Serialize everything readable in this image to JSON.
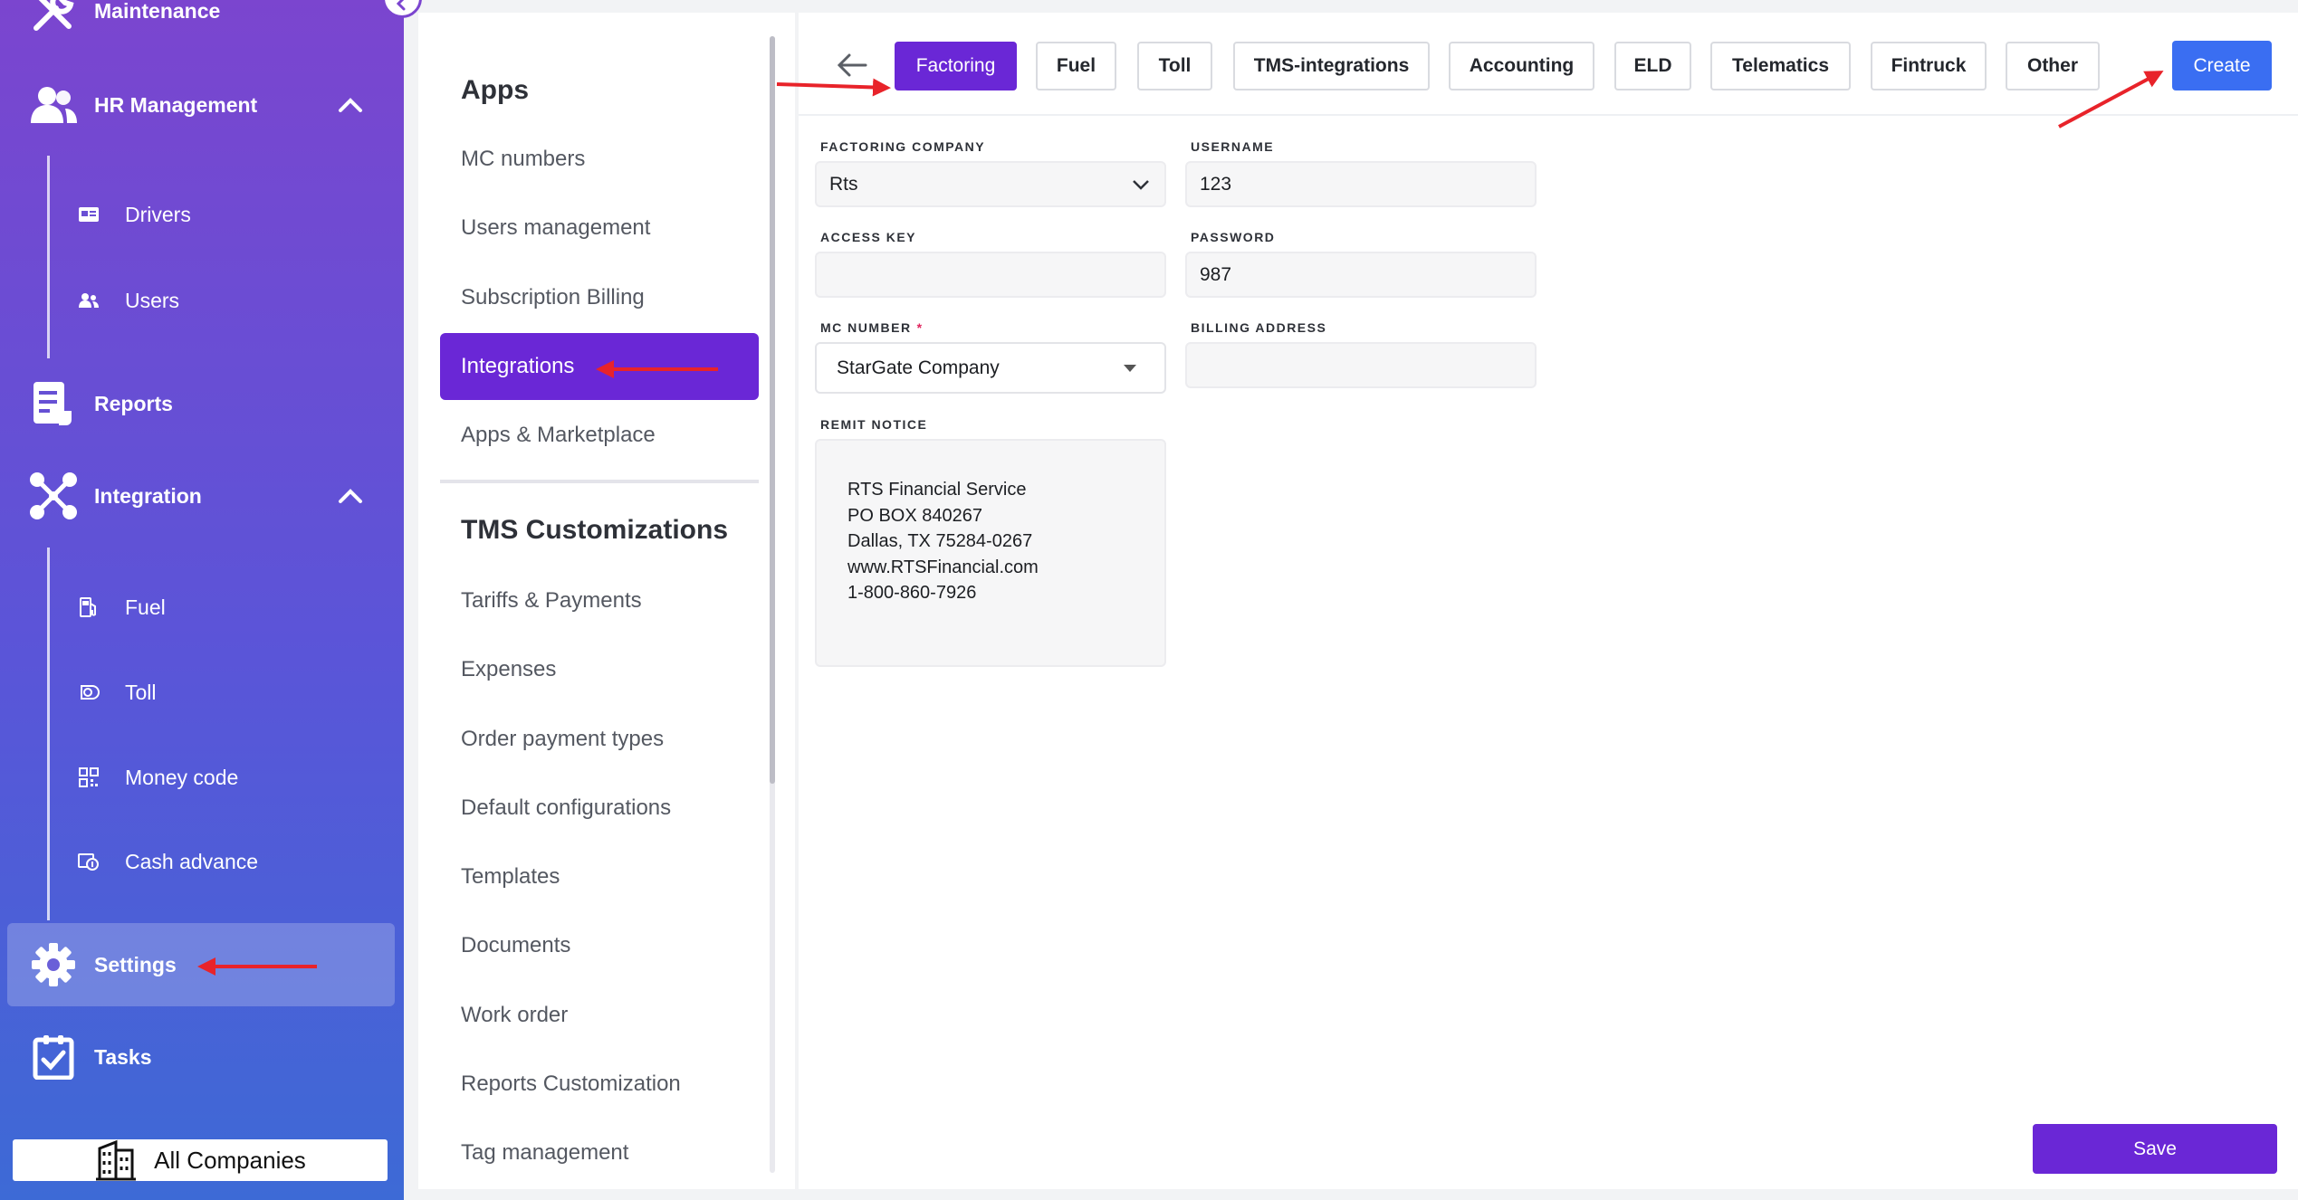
{
  "sidebar": {
    "maintenance_label": "Maintenance",
    "hr_management_label": "HR Management",
    "drivers_label": "Drivers",
    "users_label": "Users",
    "reports_label": "Reports",
    "integration_label": "Integration",
    "fuel_label": "Fuel",
    "toll_label": "Toll",
    "money_code_label": "Money code",
    "cash_advance_label": "Cash advance",
    "settings_label": "Settings",
    "tasks_label": "Tasks",
    "all_companies_label": "All Companies"
  },
  "settings_menu": {
    "apps_heading": "Apps",
    "apps_items": [
      "MC numbers",
      "Users management",
      "Subscription Billing",
      "Integrations",
      "Apps & Marketplace"
    ],
    "active_item": "Integrations",
    "tms_heading": "TMS Customizations",
    "tms_items": [
      "Tariffs & Payments",
      "Expenses",
      "Order payment types",
      "Default configurations",
      "Templates",
      "Documents",
      "Work order",
      "Reports Customization",
      "Tag management"
    ]
  },
  "tabs": {
    "items": [
      "Factoring",
      "Fuel",
      "Toll",
      "TMS-integrations",
      "Accounting",
      "ELD",
      "Telematics",
      "Fintruck",
      "Other"
    ],
    "active": "Factoring",
    "create_label": "Create"
  },
  "form": {
    "factoring_company_label": "FACTORING COMPANY",
    "factoring_company_value": "Rts",
    "username_label": "USERNAME",
    "username_value": "123",
    "access_key_label": "ACCESS KEY",
    "access_key_value": "",
    "password_label": "PASSWORD",
    "password_value": "987",
    "mc_number_label": "MC NUMBER",
    "mc_number_required": "*",
    "mc_number_value": "StarGate Company",
    "billing_address_label": "BILLING ADDRESS",
    "billing_address_value": "",
    "remit_notice_label": "REMIT NOTICE",
    "remit_notice_lines": [
      "RTS Financial Service",
      "PO BOX 840267",
      "Dallas, TX 75284-0267",
      "www.RTSFinancial.com",
      "1-800-860-7926"
    ],
    "save_label": "Save"
  },
  "colors": {
    "accent_purple": "#6a27d6",
    "create_blue": "#3a6ef2",
    "annotation_red": "#e8232a",
    "sidebar_top": "#7b45cf",
    "sidebar_bottom": "#3d6ad6"
  },
  "icons": {
    "maintenance": "wrench-icon",
    "hr_management": "people-icon",
    "drivers": "id-card-icon",
    "users": "users-icon",
    "reports": "document-icon",
    "integration": "network-icon",
    "fuel": "fuel-pump-icon",
    "toll": "toll-icon",
    "money_code": "qr-code-icon",
    "cash_advance": "cash-icon",
    "settings": "gear-icon",
    "tasks": "clipboard-check-icon",
    "all_companies": "building-icon",
    "back": "arrow-left-icon",
    "select": "chevron-down-icon"
  }
}
